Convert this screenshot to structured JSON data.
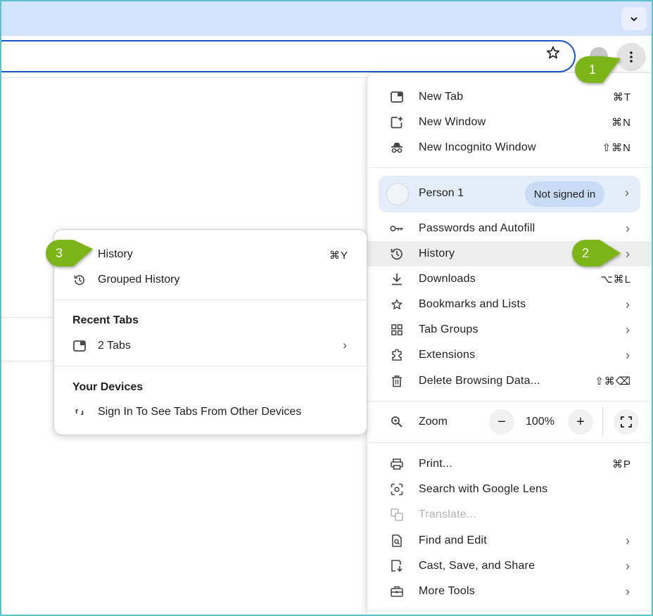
{
  "colors": {
    "tabstrip": "#d3e3fd",
    "omnibox_border": "#1a56c4",
    "profile_bg": "#e4eefb",
    "badge_bg": "#c9dcf6",
    "callout_green": "#7cb518",
    "frame": "#5dc1cf"
  },
  "toolbar": {
    "tab_search_icon": "chevron-down-icon",
    "bookmark_icon": "star-outline-icon",
    "menu_icon": "three-dots-vertical-icon"
  },
  "menu": {
    "new_tab": {
      "label": "New Tab",
      "shortcut": "⌘T",
      "icon": "new-tab-icon"
    },
    "new_window": {
      "label": "New Window",
      "shortcut": "⌘N",
      "icon": "new-window-icon"
    },
    "new_incognito": {
      "label": "New Incognito Window",
      "shortcut": "⇧⌘N",
      "icon": "incognito-icon"
    },
    "profile": {
      "name": "Person 1",
      "status": "Not signed in"
    },
    "passwords": {
      "label": "Passwords and Autofill",
      "icon": "key-icon"
    },
    "history": {
      "label": "History",
      "icon": "history-icon"
    },
    "downloads": {
      "label": "Downloads",
      "shortcut": "⌥⌘L",
      "icon": "download-icon"
    },
    "bookmarks": {
      "label": "Bookmarks and Lists",
      "icon": "star-icon"
    },
    "tab_groups": {
      "label": "Tab Groups",
      "icon": "grid-icon"
    },
    "extensions": {
      "label": "Extensions",
      "icon": "puzzle-icon"
    },
    "delete_data": {
      "label": "Delete Browsing Data...",
      "shortcut": "⇧⌘⌫",
      "icon": "trash-icon"
    },
    "zoom": {
      "label": "Zoom",
      "minus": "−",
      "value": "100%",
      "plus": "+"
    },
    "print": {
      "label": "Print...",
      "shortcut": "⌘P",
      "icon": "printer-icon"
    },
    "lens": {
      "label": "Search with Google Lens",
      "icon": "lens-icon"
    },
    "translate": {
      "label": "Translate...",
      "icon": "translate-icon"
    },
    "find_edit": {
      "label": "Find and Edit",
      "icon": "find-page-icon"
    },
    "cast": {
      "label": "Cast, Save, and Share",
      "icon": "cast-save-icon"
    },
    "more_tools": {
      "label": "More Tools",
      "icon": "toolbox-icon"
    }
  },
  "history_submenu": {
    "history": {
      "label": "History",
      "shortcut": "⌘Y"
    },
    "grouped_history": {
      "label": "Grouped History"
    },
    "recent_tabs_heading": "Recent Tabs",
    "recent_tabs_item": {
      "label": "2 Tabs"
    },
    "devices_heading": "Your Devices",
    "devices_item": {
      "label": "Sign In To See Tabs From Other Devices"
    }
  },
  "callouts": {
    "one": "1",
    "two": "2",
    "three": "3"
  }
}
